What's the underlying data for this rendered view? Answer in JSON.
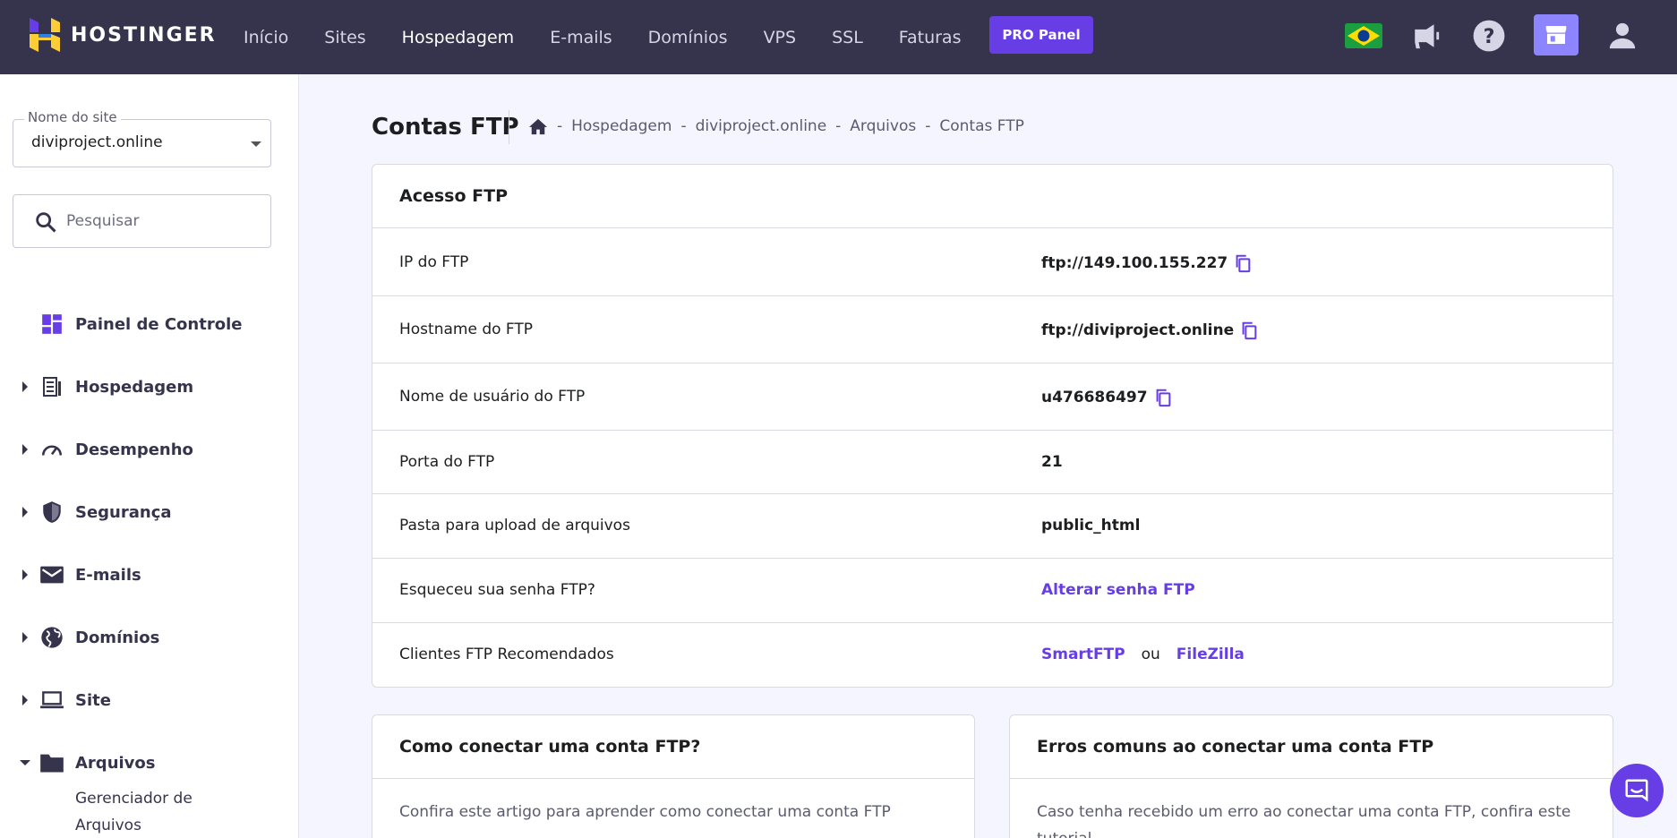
{
  "brand": {
    "name": "HOSTINGER"
  },
  "nav": {
    "items": [
      "Início",
      "Sites",
      "Hospedagem",
      "E-mails",
      "Domínios",
      "VPS",
      "SSL",
      "Faturas"
    ],
    "pro_label": "PRO Panel"
  },
  "sidebar": {
    "site_label": "Nome do site",
    "site_value": "diviproject.online",
    "search_placeholder": "Pesquisar",
    "items": [
      {
        "label": "Painel de Controle",
        "icon": "dashboard-icon"
      },
      {
        "label": "Hospedagem",
        "icon": "hosting-icon"
      },
      {
        "label": "Desempenho",
        "icon": "speedometer-icon"
      },
      {
        "label": "Segurança",
        "icon": "shield-icon"
      },
      {
        "label": "E-mails",
        "icon": "mail-icon"
      },
      {
        "label": "Domínios",
        "icon": "globe-icon"
      },
      {
        "label": "Site",
        "icon": "laptop-icon"
      },
      {
        "label": "Arquivos",
        "icon": "folder-icon"
      }
    ],
    "sub_item": "Gerenciador de Arquivos"
  },
  "page": {
    "title": "Contas FTP",
    "breadcrumb": [
      "Hospedagem",
      "diviproject.online",
      "Arquivos",
      "Contas FTP"
    ]
  },
  "ftp": {
    "heading": "Acesso FTP",
    "rows": [
      {
        "key": "IP do FTP",
        "value": "ftp://149.100.155.227"
      },
      {
        "key": "Hostname do FTP",
        "value": "ftp://diviproject.online"
      },
      {
        "key": "Nome de usuário do FTP",
        "value": "u476686497"
      },
      {
        "key": "Porta do FTP",
        "value": "21"
      },
      {
        "key": "Pasta para upload de arquivos",
        "value": "public_html"
      },
      {
        "key": "Esqueceu sua senha FTP?",
        "value": "Alterar senha FTP"
      },
      {
        "key": "Clientes FTP Recomendados",
        "client1": "SmartFTP",
        "or": "ou",
        "client2": "FileZilla"
      }
    ]
  },
  "help": {
    "connect_title": "Como conectar uma conta FTP?",
    "connect_text": "Confira este artigo para aprender como conectar uma conta FTP",
    "errors_title": "Erros comuns ao conectar uma conta FTP",
    "errors_text": "Caso tenha recebido um erro ao conectar uma conta FTP, confira este tutorial"
  },
  "colors": {
    "accent": "#673de6",
    "topbar": "#36344d",
    "background": "#f4f5ff"
  }
}
